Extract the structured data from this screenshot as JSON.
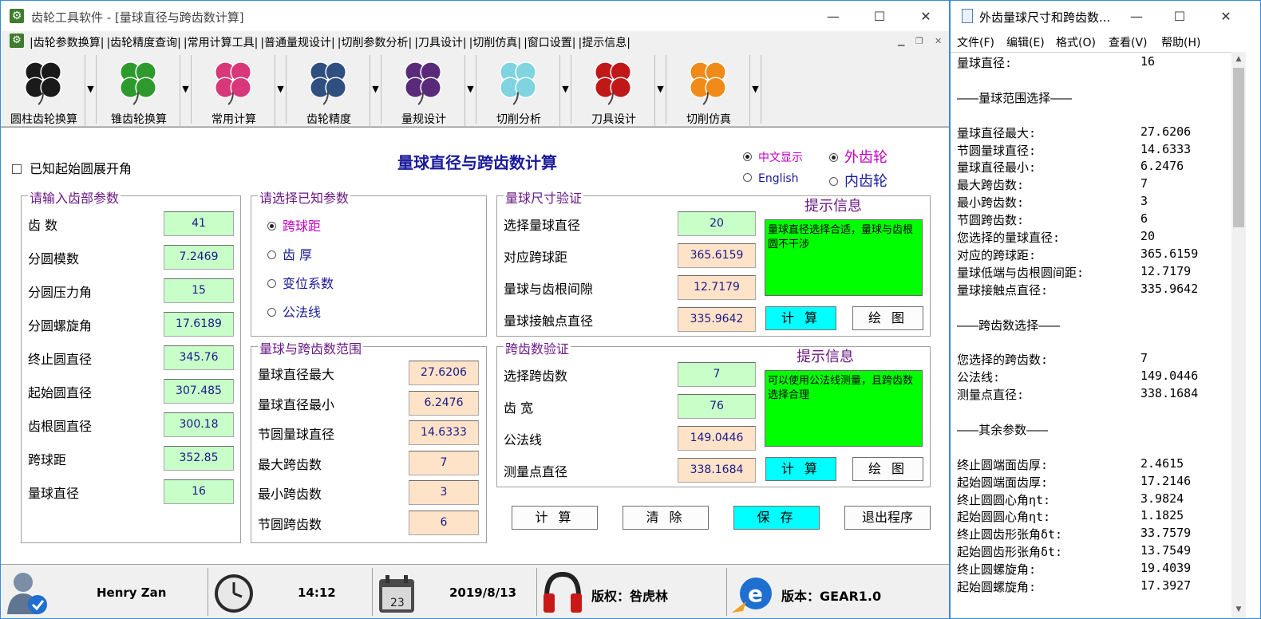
{
  "main": {
    "title": "齿轮工具软件 - [量球直径与跨齿数计算]",
    "menu": [
      "|齿轮参数换算|",
      "|齿轮精度查询|",
      "|常用计算工具|",
      "|普通量规设计|",
      "|切削参数分析|",
      "|刀具设计|",
      "|切削仿真|",
      "|窗口设置|",
      "|提示信息|"
    ],
    "toolbar": [
      {
        "label": "圆柱齿轮换算",
        "color": "#1a1a1a",
        "icon": "clover-black-icon"
      },
      {
        "label": "锥齿轮换算",
        "color": "#2e9a2e",
        "icon": "clover-green-icon"
      },
      {
        "label": "常用计算",
        "color": "#d8377a",
        "icon": "clover-pink-icon"
      },
      {
        "label": "齿轮精度",
        "color": "#2f4f80",
        "icon": "clover-navy-icon"
      },
      {
        "label": "量规设计",
        "color": "#5a2a7a",
        "icon": "clover-purple-icon"
      },
      {
        "label": "切削分析",
        "color": "#7fd4e0",
        "icon": "clover-cyan-icon"
      },
      {
        "label": "刀具设计",
        "color": "#c01818",
        "icon": "clover-red-icon"
      },
      {
        "label": "切削仿真",
        "color": "#f08a18",
        "icon": "clover-orange-icon"
      }
    ]
  },
  "form": {
    "checkbox_label": "已知起始圆展开角",
    "title": "量球直径与跨齿数计算",
    "lang_cn": "中文显示",
    "lang_en": "English",
    "ext_gear": "外齿轮",
    "int_gear": "内齿轮",
    "input_group": {
      "title": "请输入齿部参数",
      "fields": [
        {
          "label": "齿 数",
          "value": "41"
        },
        {
          "label": "分圆模数",
          "value": "7.2469"
        },
        {
          "label": "分圆压力角",
          "value": "15"
        },
        {
          "label": "分圆螺旋角",
          "value": "17.6189"
        },
        {
          "label": "终止圆直径",
          "value": "345.76"
        },
        {
          "label": "起始圆直径",
          "value": "307.485"
        },
        {
          "label": "齿根圆直径",
          "value": "300.18"
        },
        {
          "label": "跨球距",
          "value": "352.85"
        },
        {
          "label": "量球直径",
          "value": "16"
        }
      ]
    },
    "known_group": {
      "title": "请选择已知参数",
      "options": [
        "跨球距",
        "齿 厚",
        "变位系数",
        "公法线"
      ]
    },
    "range_group": {
      "title": "量球与跨齿数范围",
      "fields": [
        {
          "label": "量球直径最大",
          "value": "27.6206"
        },
        {
          "label": "量球直径最小",
          "value": "6.2476"
        },
        {
          "label": "节圆量球直径",
          "value": "14.6333"
        },
        {
          "label": "最大跨齿数",
          "value": "7"
        },
        {
          "label": "最小跨齿数",
          "value": "3"
        },
        {
          "label": "节圆跨齿数",
          "value": "6"
        }
      ]
    },
    "ball_group": {
      "title": "量球尺寸验证",
      "hint_title": "提示信息",
      "hint": "量球直径选择合适，量球与齿根圆不干涉",
      "calc": "计 算",
      "draw": "绘 图",
      "fields": [
        {
          "label": "选择量球直径",
          "value": "20"
        },
        {
          "label": "对应跨球距",
          "value": "365.6159"
        },
        {
          "label": "量球与齿根间隙",
          "value": "12.7179"
        },
        {
          "label": "量球接触点直径",
          "value": "335.9642"
        }
      ]
    },
    "span_group": {
      "title": "跨齿数验证",
      "hint_title": "提示信息",
      "hint": "可以使用公法线测量，且跨齿数选择合理",
      "calc": "计 算",
      "draw": "绘 图",
      "fields": [
        {
          "label": "选择跨齿数",
          "value": "7"
        },
        {
          "label": "齿 宽",
          "value": "76"
        },
        {
          "label": "公法线",
          "value": "149.0446"
        },
        {
          "label": "测量点直径",
          "value": "338.1684"
        }
      ]
    },
    "buttons": {
      "calc": "计 算",
      "clear": "清 除",
      "save": "保 存",
      "exit": "退出程序"
    }
  },
  "status": {
    "user": "Henry Zan",
    "time": "14:12",
    "date_icon": "23",
    "date": "2019/8/13",
    "copyright": "版权：咎虎林",
    "version": "版本：GEAR1.0"
  },
  "notepad": {
    "title": "外齿量球尺寸和跨齿数...",
    "menu": [
      "文件(F)",
      "编辑(E)",
      "格式(O)",
      "查看(V)",
      "帮助(H)"
    ],
    "lines": [
      {
        "k": "量球直径:",
        "v": "16"
      },
      {
        "k": "",
        "v": ""
      },
      {
        "k": "———量球范围选择———",
        "v": ""
      },
      {
        "k": "",
        "v": ""
      },
      {
        "k": "量球直径最大:",
        "v": "27.6206"
      },
      {
        "k": "节圆量球直径:",
        "v": "14.6333"
      },
      {
        "k": "量球直径最小:",
        "v": "6.2476"
      },
      {
        "k": "最大跨齿数:",
        "v": "7"
      },
      {
        "k": "最小跨齿数:",
        "v": "3"
      },
      {
        "k": "节圆跨齿数:",
        "v": "6"
      },
      {
        "k": "您选择的量球直径:",
        "v": "20"
      },
      {
        "k": "对应的跨球距:",
        "v": "365.6159"
      },
      {
        "k": "量球低端与齿根圆间距:",
        "v": "12.7179"
      },
      {
        "k": "量球接触点直径:",
        "v": "335.9642"
      },
      {
        "k": "",
        "v": ""
      },
      {
        "k": "———跨齿数选择———",
        "v": ""
      },
      {
        "k": "",
        "v": ""
      },
      {
        "k": "您选择的跨齿数:",
        "v": "7"
      },
      {
        "k": "公法线:",
        "v": "149.0446"
      },
      {
        "k": "测量点直径:",
        "v": "338.1684"
      },
      {
        "k": "",
        "v": ""
      },
      {
        "k": "———其余参数———",
        "v": ""
      },
      {
        "k": "",
        "v": ""
      },
      {
        "k": "终止圆端面齿厚:",
        "v": "2.4615"
      },
      {
        "k": "起始圆端面齿厚:",
        "v": "17.2146"
      },
      {
        "k": "终止圆圆心角ηt:",
        "v": "3.9824"
      },
      {
        "k": "起始圆圆心角ηt:",
        "v": "1.1825"
      },
      {
        "k": "终止圆齿形张角δt:",
        "v": "33.7579"
      },
      {
        "k": "起始圆齿形张角δt:",
        "v": "13.7549"
      },
      {
        "k": "终止圆螺旋角:",
        "v": "19.4039"
      },
      {
        "k": "起始圆螺旋角:",
        "v": "17.3927"
      }
    ]
  }
}
